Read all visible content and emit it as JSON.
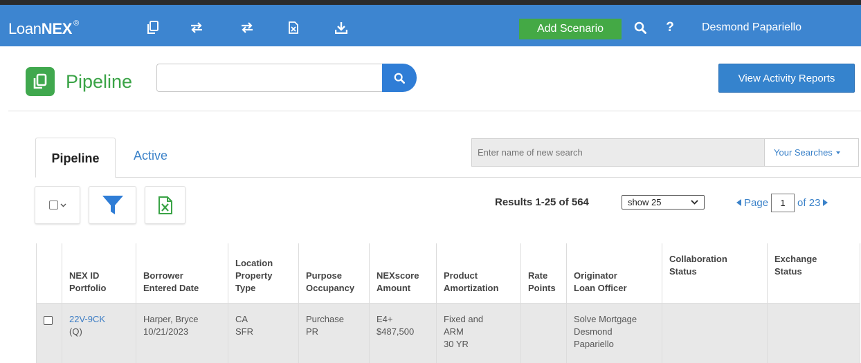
{
  "navbar": {
    "logo_light": "Loan",
    "logo_bold": "NEX",
    "logo_reg": "®",
    "add_scenario_label": "Add Scenario",
    "user_name": "Desmond Papariello",
    "icons": [
      "copy-icon",
      "transfer-icon",
      "transfer-icon",
      "excel-file-icon",
      "download-icon",
      "search-icon",
      "help-icon"
    ]
  },
  "header": {
    "title": "Pipeline",
    "search_value": "",
    "view_reports_label": "View Activity Reports"
  },
  "tabs": [
    {
      "label": "Pipeline",
      "active": true
    },
    {
      "label": "Active",
      "active": false
    }
  ],
  "saved_search": {
    "placeholder": "Enter name of new search",
    "your_searches_label": "Your Searches"
  },
  "results": {
    "summary": "Results 1-25 of 564",
    "show_option": "show 25",
    "page_label": "Page",
    "page_value": "1",
    "of_label": "of 23"
  },
  "table": {
    "headers": [
      "",
      "NEX ID\nPortfolio",
      "Borrower\nEntered Date",
      "Location\nProperty\nType",
      "Purpose\nOccupancy",
      "NEXscore\nAmount",
      "Product\nAmortization",
      "Rate\nPoints",
      "Originator\nLoan Officer",
      "Collaboration\nStatus",
      "Exchange\nStatus"
    ],
    "rows": [
      {
        "nex_id": "22V-9CK",
        "portfolio": "(Q)",
        "borrower": "Harper, Bryce",
        "entered_date": "10/21/2023",
        "location": "CA",
        "property_type": "SFR",
        "purpose": "Purchase",
        "occupancy": "PR",
        "nexscore": "E4+",
        "amount": "$487,500",
        "product_1": "Fixed and",
        "product_2": "ARM",
        "amortization": "30 YR",
        "rate": "",
        "points": "",
        "originator": "Solve Mortgage",
        "loan_officer_1": "Desmond",
        "loan_officer_2": "Papariello",
        "collaboration_status": "",
        "exchange_status": ""
      }
    ]
  },
  "colors": {
    "navbar": "#3d85d0",
    "add_scenario": "#44a945",
    "page_icon": "#40a84e",
    "title": "#3aa346",
    "primary_button": "#3583cd",
    "link": "#3b82c9",
    "row_background": "#e8e8e8"
  }
}
